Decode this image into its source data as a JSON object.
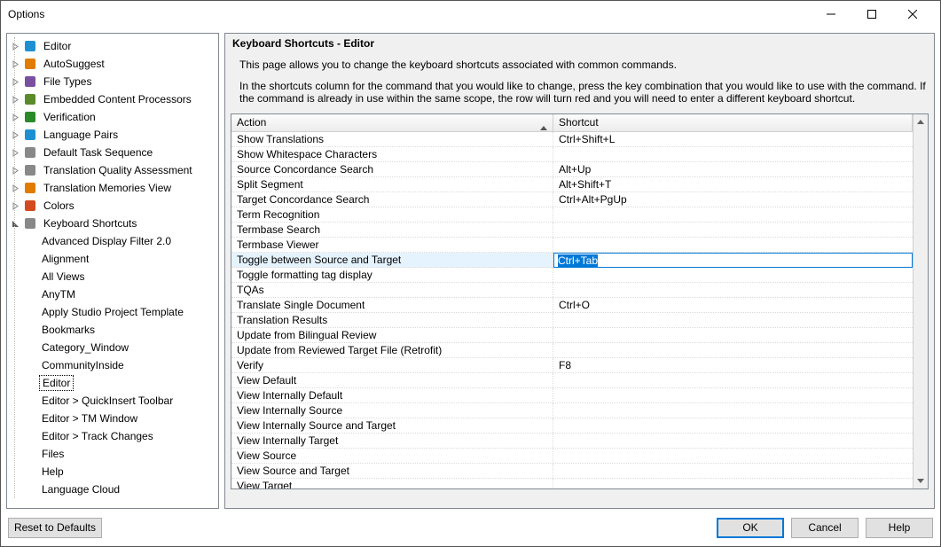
{
  "window": {
    "title": "Options"
  },
  "tree": {
    "top": [
      {
        "label": "Editor",
        "icon": "pencil",
        "exp": "closed"
      },
      {
        "label": "AutoSuggest",
        "icon": "bulb",
        "exp": "closed"
      },
      {
        "label": "File Types",
        "icon": "file",
        "exp": "closed"
      },
      {
        "label": "Embedded Content Processors",
        "icon": "tag",
        "exp": "closed"
      },
      {
        "label": "Verification",
        "icon": "check",
        "exp": "closed"
      },
      {
        "label": "Language Pairs",
        "icon": "globe",
        "exp": "closed"
      },
      {
        "label": "Default Task Sequence",
        "icon": "clip",
        "exp": "closed"
      },
      {
        "label": "Translation Quality Assessment",
        "icon": "doc",
        "exp": "closed"
      },
      {
        "label": "Translation Memories View",
        "icon": "bars",
        "exp": "closed"
      },
      {
        "label": "Colors",
        "icon": "palette",
        "exp": "closed"
      }
    ],
    "shortcuts": {
      "label": "Keyboard Shortcuts",
      "icon": "keyboard",
      "exp": "open"
    },
    "children": [
      "Advanced Display Filter 2.0",
      "Alignment",
      "All Views",
      "AnyTM",
      "Apply Studio Project Template",
      "Bookmarks",
      "Category_Window",
      "CommunityInside",
      "Editor",
      "Editor > QuickInsert Toolbar",
      "Editor > TM Window",
      "Editor > Track Changes",
      "Files",
      "Help",
      "Language Cloud"
    ],
    "selected": "Editor"
  },
  "panel": {
    "title": "Keyboard Shortcuts - Editor",
    "desc": "This page allows you to change the keyboard shortcuts associated with common commands.",
    "desc2": "In the shortcuts column for the command that you would like to change, press the key combination that you would like to use with the command.  If the command is already in use within the same scope, the row will turn red and you will need to enter a different keyboard shortcut.",
    "col_action": "Action",
    "col_shortcut": "Shortcut"
  },
  "rows": [
    {
      "action": "Show Translations",
      "shortcut": "Ctrl+Shift+L"
    },
    {
      "action": "Show Whitespace Characters",
      "shortcut": ""
    },
    {
      "action": "Source Concordance Search",
      "shortcut": "Alt+Up"
    },
    {
      "action": "Split Segment",
      "shortcut": "Alt+Shift+T"
    },
    {
      "action": "Target Concordance Search",
      "shortcut": "Ctrl+Alt+PgUp"
    },
    {
      "action": "Term Recognition",
      "shortcut": ""
    },
    {
      "action": "Termbase Search",
      "shortcut": ""
    },
    {
      "action": "Termbase Viewer",
      "shortcut": ""
    },
    {
      "action": "Toggle between Source and Target",
      "shortcut": "Ctrl+Tab",
      "selected": true
    },
    {
      "action": "Toggle formatting tag display",
      "shortcut": ""
    },
    {
      "action": "TQAs",
      "shortcut": ""
    },
    {
      "action": "Translate Single Document",
      "shortcut": "Ctrl+O"
    },
    {
      "action": "Translation Results",
      "shortcut": ""
    },
    {
      "action": "Update from Bilingual Review",
      "shortcut": ""
    },
    {
      "action": "Update from Reviewed Target File (Retrofit)",
      "shortcut": ""
    },
    {
      "action": "Verify",
      "shortcut": "F8"
    },
    {
      "action": "View Default",
      "shortcut": ""
    },
    {
      "action": "View Internally Default",
      "shortcut": ""
    },
    {
      "action": "View Internally Source",
      "shortcut": ""
    },
    {
      "action": "View Internally Source and Target",
      "shortcut": ""
    },
    {
      "action": "View Internally Target",
      "shortcut": ""
    },
    {
      "action": "View Source",
      "shortcut": ""
    },
    {
      "action": "View Source and Target",
      "shortcut": ""
    },
    {
      "action": "View Target",
      "shortcut": ""
    }
  ],
  "footer": {
    "reset": "Reset to Defaults",
    "ok": "OK",
    "cancel": "Cancel",
    "help": "Help"
  }
}
